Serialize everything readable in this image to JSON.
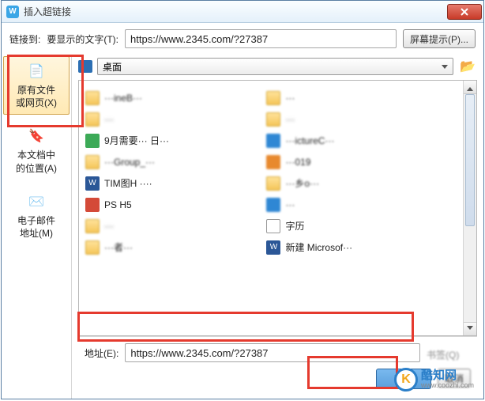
{
  "window": {
    "title": "插入超链接"
  },
  "top": {
    "link_to": "链接到:",
    "display_text_label": "要显示的文字(T):",
    "display_text_value": "https://www.2345.com/?27387",
    "screen_tip": "屏幕提示(P)..."
  },
  "sidebar": {
    "items": [
      {
        "label": "原有文件\n或网页(X)"
      },
      {
        "label": "本文档中\n的位置(A)"
      },
      {
        "label": "电子邮件\n地址(M)"
      }
    ]
  },
  "location": {
    "dropdown": "桌面"
  },
  "files": {
    "items": [
      {
        "name": "···ineB···",
        "type": "folder"
      },
      {
        "name": "···",
        "type": "folder"
      },
      {
        "name": "9月需要··· 日···",
        "type": "green"
      },
      {
        "name": "···Group_···",
        "type": "folder"
      },
      {
        "name": "TIM图H ····",
        "type": "word"
      },
      {
        "name": "···ictureC···",
        "type": "blue"
      },
      {
        "name": "···乡o···",
        "type": "folder"
      },
      {
        "name": "PS H5",
        "type": "red"
      },
      {
        "name": "···",
        "type": "blue"
      },
      {
        "name": "字历",
        "type": "txt"
      },
      {
        "name": "新建 Microsof···",
        "type": "word"
      },
      {
        "name": "···者···",
        "type": "folder"
      },
      {
        "name": "",
        "type": "folder"
      },
      {
        "name": "···019",
        "type": "orange"
      }
    ]
  },
  "bottom": {
    "addr_label": "地址(E):",
    "addr_value": "https://www.2345.com/?27387",
    "bookmark": "书签(Q)",
    "ok": "确定",
    "cancel": "取消"
  },
  "watermark": {
    "name": "酷知网",
    "url": "www.coozhi.com",
    "letter": "K"
  }
}
